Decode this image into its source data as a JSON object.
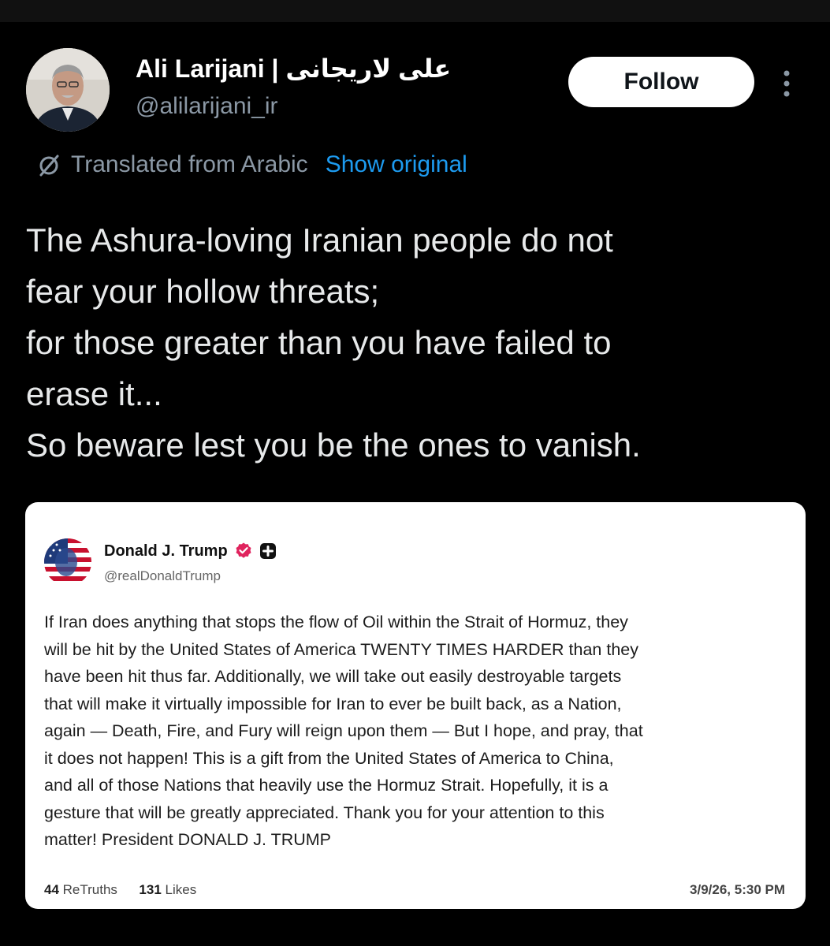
{
  "author": {
    "display_name": "Ali Larijani | علی لاریجانی",
    "handle": "@alilarijani_ir",
    "avatar_icon": "person-portrait-avatar"
  },
  "actions": {
    "follow_label": "Follow",
    "more_icon": "more-vertical-icon"
  },
  "translation": {
    "icon": "globe-slash-icon",
    "label": "Translated from Arabic",
    "show_original_label": "Show original"
  },
  "tweet": {
    "lines": [
      "The Ashura-loving Iranian people do not",
      "fear your hollow threats;",
      "for those greater than you have failed to",
      "erase it...",
      "So beware lest you be the ones to vanish."
    ]
  },
  "quoted_post": {
    "display_name": "Donald J. Trump",
    "handle": "@realDonaldTrump",
    "verified_color": "#e0245e",
    "body_lines": [
      "If Iran does anything that stops the flow of Oil within the Strait of Hormuz, they",
      "will be hit by the United States of America TWENTY TIMES HARDER than they",
      "have been hit thus far. Additionally, we will take out easily destroyable targets",
      "that will make it virtually impossible for Iran to ever be built back, as a Nation,",
      "again — Death, Fire, and Fury will reign upon them — But I hope, and pray, that",
      "it does not happen! This is a gift from the United States of America to China,",
      "and all of those Nations that heavily use the Hormuz Strait. Hopefully, it is a",
      "gesture that will be greatly appreciated. Thank you for your attention to this",
      "matter! President DONALD J. TRUMP"
    ],
    "retruths_count": "44",
    "retruths_label": "ReTruths",
    "likes_count": "131",
    "likes_label": "Likes",
    "timestamp": "3/9/26, 5:30 PM"
  },
  "colors": {
    "background": "#000000",
    "link_blue": "#1d9bf0",
    "muted": "#8b98a5"
  }
}
